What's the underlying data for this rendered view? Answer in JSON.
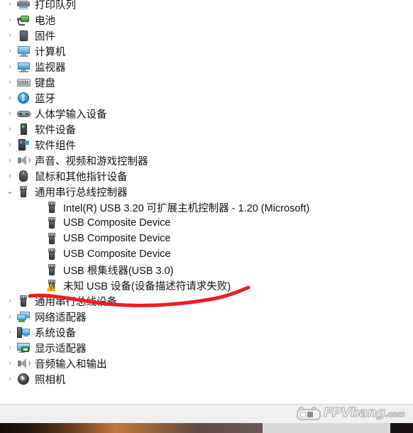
{
  "window": {
    "app": "Device Manager",
    "watermark": {
      "text": "FPVbang",
      "domain": ".com",
      "icon": "fpv-camera-icon"
    }
  },
  "tree": [
    {
      "label": "打印队列",
      "icon": "printer-icon",
      "level": 1,
      "state": "collapsed",
      "clipped": true
    },
    {
      "label": "电池",
      "icon": "battery-icon",
      "level": 1,
      "state": "collapsed"
    },
    {
      "label": "固件",
      "icon": "firmware-chip-icon",
      "level": 1,
      "state": "collapsed"
    },
    {
      "label": "计算机",
      "icon": "computer-icon",
      "level": 1,
      "state": "collapsed"
    },
    {
      "label": "监视器",
      "icon": "monitor-icon",
      "level": 1,
      "state": "collapsed"
    },
    {
      "label": "键盘",
      "icon": "keyboard-icon",
      "level": 1,
      "state": "collapsed"
    },
    {
      "label": "蓝牙",
      "icon": "bluetooth-icon",
      "level": 1,
      "state": "collapsed"
    },
    {
      "label": "人体学输入设备",
      "icon": "hid-gamepad-icon",
      "level": 1,
      "state": "collapsed"
    },
    {
      "label": "软件设备",
      "icon": "software-device-icon",
      "level": 1,
      "state": "collapsed"
    },
    {
      "label": "软件组件",
      "icon": "software-component-icon",
      "level": 1,
      "state": "collapsed"
    },
    {
      "label": "声音、视频和游戏控制器",
      "icon": "speaker-icon",
      "level": 1,
      "state": "collapsed"
    },
    {
      "label": "鼠标和其他指针设备",
      "icon": "mouse-icon",
      "level": 1,
      "state": "collapsed"
    },
    {
      "label": "通用串行总线控制器",
      "icon": "usb-icon",
      "level": 1,
      "state": "expanded"
    },
    {
      "label": "Intel(R) USB 3.20 可扩展主机控制器 - 1.20 (Microsoft)",
      "icon": "usb-icon",
      "level": 2,
      "state": "leaf"
    },
    {
      "label": "USB Composite Device",
      "icon": "usb-icon",
      "level": 2,
      "state": "leaf"
    },
    {
      "label": "USB Composite Device",
      "icon": "usb-icon",
      "level": 2,
      "state": "leaf"
    },
    {
      "label": "USB Composite Device",
      "icon": "usb-icon",
      "level": 2,
      "state": "leaf"
    },
    {
      "label": "USB 根集线器(USB 3.0)",
      "icon": "usb-icon",
      "level": 2,
      "state": "leaf"
    },
    {
      "label": "未知 USB 设备(设备描述符请求失败)",
      "icon": "usb-warning-icon",
      "level": 2,
      "state": "leaf",
      "warning": true,
      "highlighted": true
    },
    {
      "label": "通用串行总线设备",
      "icon": "usb-icon",
      "level": 1,
      "state": "collapsed"
    },
    {
      "label": "网络适配器",
      "icon": "network-adapter-icon",
      "level": 1,
      "state": "collapsed"
    },
    {
      "label": "系统设备",
      "icon": "system-device-icon",
      "level": 1,
      "state": "collapsed"
    },
    {
      "label": "显示适配器",
      "icon": "display-adapter-icon",
      "level": 1,
      "state": "collapsed"
    },
    {
      "label": "音频输入和输出",
      "icon": "audio-io-icon",
      "level": 1,
      "state": "collapsed"
    },
    {
      "label": "照相机",
      "icon": "camera-icon",
      "level": 1,
      "state": "collapsed"
    }
  ],
  "glyphs": {
    "collapsed": "›",
    "expanded": "⌄",
    "warning": "!"
  },
  "annotation": {
    "type": "hand-drawn-underline",
    "color": "#ee1c25",
    "target_label": "未知 USB 设备(设备描述符请求失败)"
  }
}
